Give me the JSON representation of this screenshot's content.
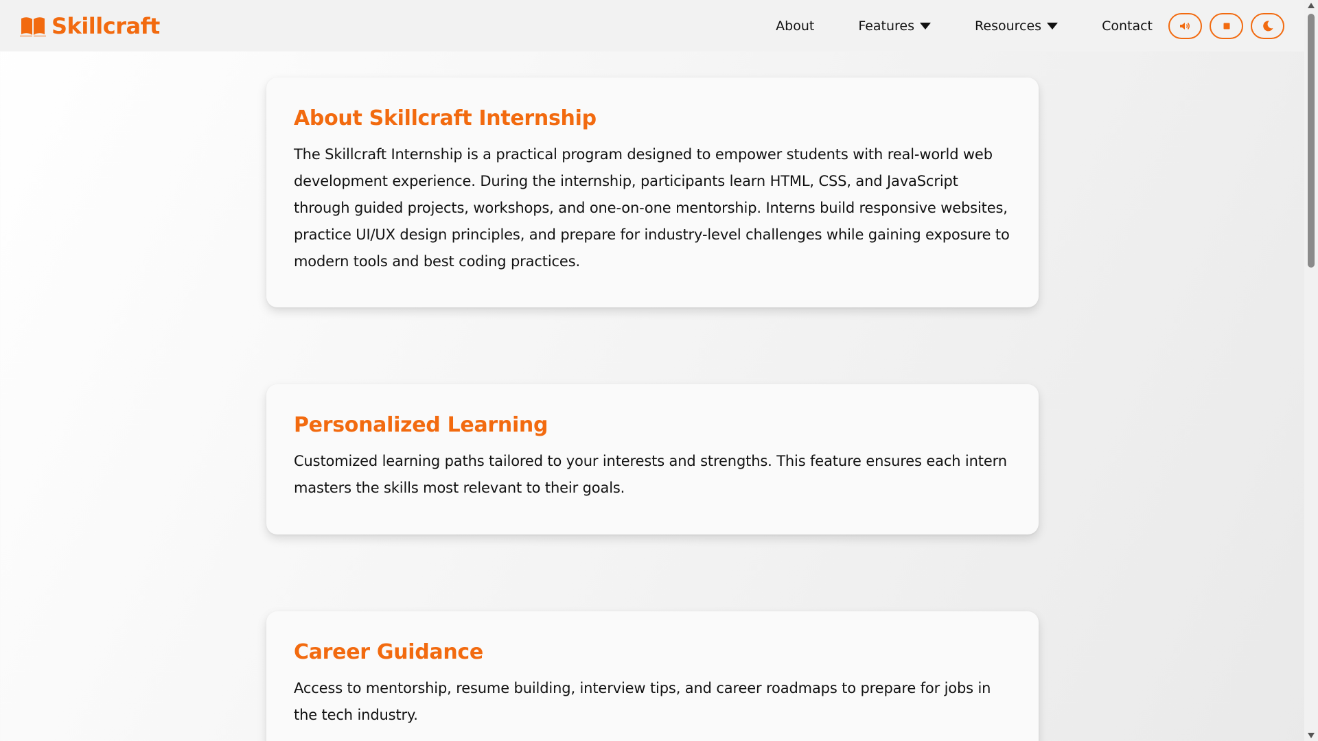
{
  "brand": {
    "name": "Skillcraft",
    "icon": "open-book-icon",
    "color": "#f26a0f"
  },
  "nav": {
    "items": [
      {
        "label": "About",
        "has_dropdown": false
      },
      {
        "label": "Features",
        "has_dropdown": true
      },
      {
        "label": "Resources",
        "has_dropdown": true
      },
      {
        "label": "Contact",
        "has_dropdown": false
      }
    ]
  },
  "controls": [
    {
      "name": "speak-button",
      "icon": "speaker-icon"
    },
    {
      "name": "stop-button",
      "icon": "stop-icon"
    },
    {
      "name": "dark-mode-toggle",
      "icon": "moon-icon"
    }
  ],
  "cards": [
    {
      "title": "About Skillcraft Internship",
      "text": "The Skillcraft Internship is a practical program designed to empower students with real-world web development experience. During the internship, participants learn HTML, CSS, and JavaScript through guided projects, workshops, and one-on-one mentorship. Interns build responsive websites, practice UI/UX design principles, and prepare for industry-level challenges while gaining exposure to modern tools and best coding practices."
    },
    {
      "title": "Personalized Learning",
      "text": "Customized learning paths tailored to your interests and strengths. This feature ensures each intern masters the skills most relevant to their goals."
    },
    {
      "title": "Career Guidance",
      "text": "Access to mentorship, resume building, interview tips, and career roadmaps to prepare for jobs in the tech industry."
    }
  ],
  "theme": {
    "accent": "#f26a0f",
    "card_bg": "#fafafa",
    "header_bg": "#f2f2f2"
  }
}
